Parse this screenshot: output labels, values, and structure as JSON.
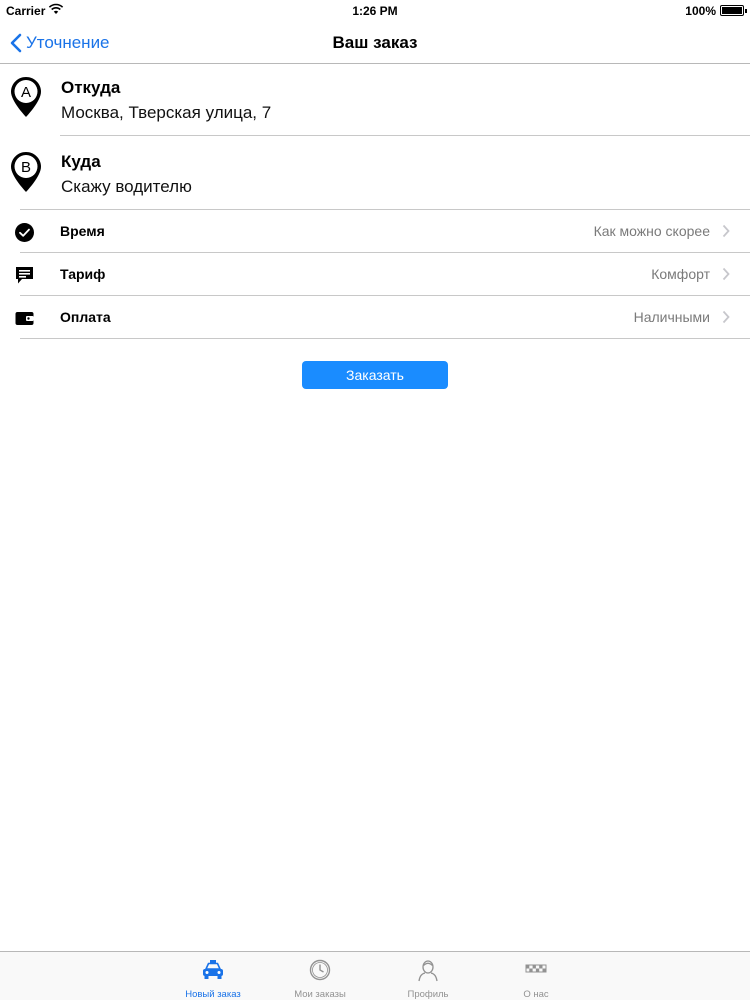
{
  "status_bar": {
    "carrier": "Carrier",
    "time": "1:26 PM",
    "battery": "100%"
  },
  "nav": {
    "back_label": "Уточнение",
    "title": "Ваш заказ"
  },
  "route": {
    "from": {
      "pin_letter": "A",
      "title": "Откуда",
      "value": "Москва, Тверская улица, 7"
    },
    "to": {
      "pin_letter": "B",
      "title": "Куда",
      "value": "Скажу водителю"
    }
  },
  "options": [
    {
      "icon": "clock-check-icon",
      "label": "Время",
      "value": "Как можно скорее"
    },
    {
      "icon": "tariff-chat-icon",
      "label": "Тариф",
      "value": "Комфорт"
    },
    {
      "icon": "wallet-icon",
      "label": "Оплата",
      "value": "Наличными"
    }
  ],
  "order_button": "Заказать",
  "tabs": [
    {
      "icon": "taxi-icon",
      "label": "Новый заказ",
      "active": true
    },
    {
      "icon": "clock-icon",
      "label": "Мои заказы",
      "active": false
    },
    {
      "icon": "profile-icon",
      "label": "Профиль",
      "active": false
    },
    {
      "icon": "taxi-checker-icon",
      "label": "О нас",
      "active": false
    }
  ],
  "colors": {
    "accent": "#1a73e8",
    "button": "#1a8cff",
    "secondary_text": "#7a7a7a"
  }
}
